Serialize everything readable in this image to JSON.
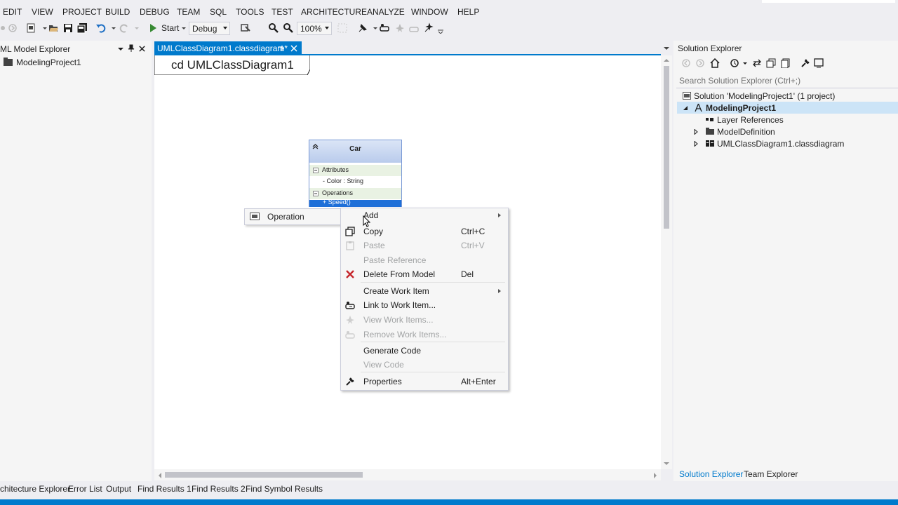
{
  "menu": [
    "EDIT",
    "VIEW",
    "PROJECT",
    "BUILD",
    "DEBUG",
    "TEAM",
    "SQL",
    "TOOLS",
    "TEST",
    "ARCHITECTURE",
    "ANALYZE",
    "WINDOW",
    "HELP"
  ],
  "toolbar": {
    "start_label": "Start",
    "config_value": "Debug",
    "zoom_value": "100%"
  },
  "left_panel": {
    "title": "ML Model Explorer",
    "root_item": "ModelingProject1"
  },
  "editor": {
    "tab_title": "UMLClassDiagram1.classdiagram*",
    "frame_label": "cd UMLClassDiagram1"
  },
  "uml_class": {
    "name": "Car",
    "attributes_header": "Attributes",
    "attribute_1": "- Color : String",
    "operations_header": "Operations",
    "operation_1": "+ Speed()"
  },
  "submenu": {
    "item": "Operation"
  },
  "context_menu": {
    "add": "Add",
    "copy": "Copy",
    "copy_shortcut": "Ctrl+C",
    "paste": "Paste",
    "paste_shortcut": "Ctrl+V",
    "paste_reference": "Paste Reference",
    "delete": "Delete From Model",
    "delete_shortcut": "Del",
    "create_work_item": "Create Work Item",
    "link_work_item": "Link to Work Item...",
    "view_work_items": "View Work Items...",
    "remove_work_items": "Remove Work Items...",
    "generate_code": "Generate Code",
    "view_code": "View Code",
    "properties": "Properties",
    "properties_shortcut": "Alt+Enter"
  },
  "solution_explorer": {
    "title": "Solution Explorer",
    "search_placeholder": "Search Solution Explorer (Ctrl+;)",
    "solution": "Solution 'ModelingProject1' (1 project)",
    "project": "ModelingProject1",
    "item_1": "Layer References",
    "item_2": "ModelDefinition",
    "item_3": "UMLClassDiagram1.classdiagram",
    "tab_1": "Solution Explorer",
    "tab_2": "Team Explorer"
  },
  "bottom_tabs": [
    "chitecture Explorer",
    "Error List",
    "Output",
    "Find Results 1",
    "Find Results 2",
    "Find Symbol Results"
  ],
  "colors": {
    "accent": "#007acc",
    "class_header": "#c5d4ee",
    "section_bg": "#e9f2e3"
  }
}
